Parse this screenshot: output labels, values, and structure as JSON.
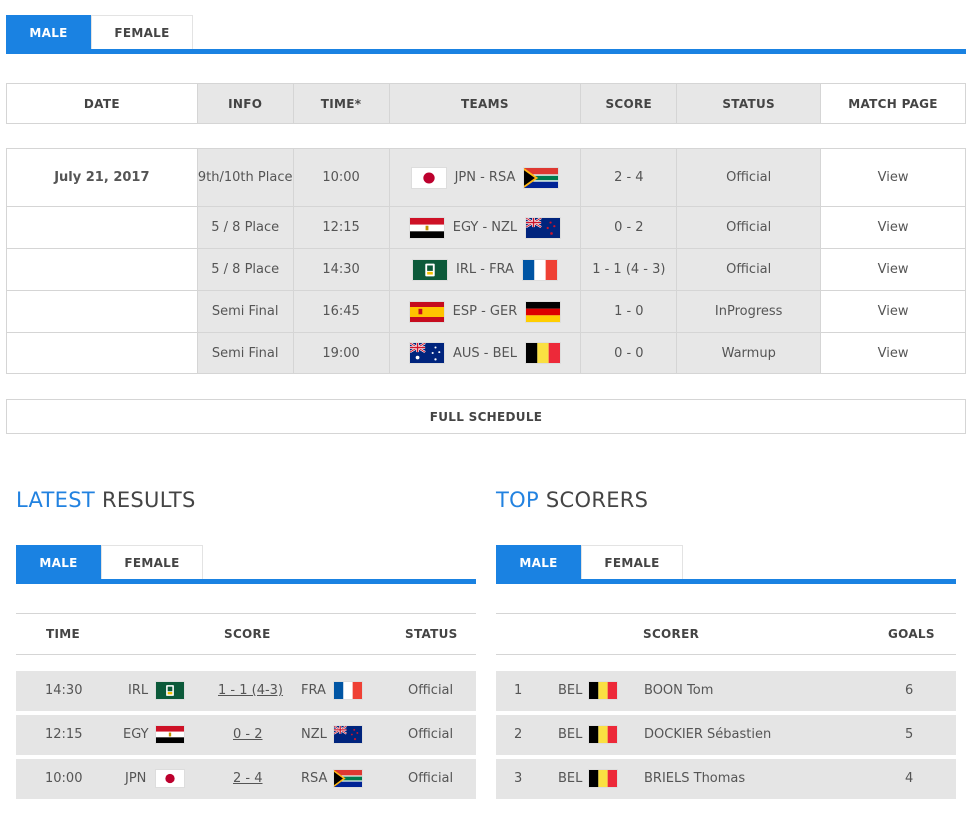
{
  "top_tabs": [
    "MALE",
    "FEMALE"
  ],
  "schedule": {
    "headers": [
      "DATE",
      "INFO",
      "TIME*",
      "TEAMS",
      "SCORE",
      "STATUS",
      "MATCH PAGE"
    ],
    "date": "July 21, 2017",
    "rows": [
      {
        "info": "9th/10th Place",
        "time": "10:00",
        "teams": "JPN - RSA",
        "flag1": "jpn",
        "flag2": "rsa",
        "score": "2 - 4",
        "status": "Official",
        "link": "View"
      },
      {
        "info": "5 / 8 Place",
        "time": "12:15",
        "teams": "EGY - NZL",
        "flag1": "egy",
        "flag2": "nzl",
        "score": "0 - 2",
        "status": "Official",
        "link": "View"
      },
      {
        "info": "5 / 8 Place",
        "time": "14:30",
        "teams": "IRL - FRA",
        "flag1": "irl",
        "flag2": "fra",
        "score": "1 - 1 (4 - 3)",
        "status": "Official",
        "link": "View"
      },
      {
        "info": "Semi Final",
        "time": "16:45",
        "teams": "ESP - GER",
        "flag1": "esp",
        "flag2": "ger",
        "score": "1 - 0",
        "status": "InProgress",
        "link": "View"
      },
      {
        "info": "Semi Final",
        "time": "19:00",
        "teams": "AUS - BEL",
        "flag1": "aus",
        "flag2": "bel",
        "score": "0 - 0",
        "status": "Warmup",
        "link": "View"
      }
    ],
    "full_schedule": "FULL SCHEDULE"
  },
  "latest": {
    "title_hl": "LATEST",
    "title_rest": " RESULTS",
    "tabs": [
      "MALE",
      "FEMALE"
    ],
    "headers": [
      "TIME",
      "SCORE",
      "STATUS"
    ],
    "rows": [
      {
        "time": "14:30",
        "team1": "IRL",
        "flag1": "irl",
        "score": "1 - 1 (4-3)",
        "team2": "FRA",
        "flag2": "fra",
        "status": "Official"
      },
      {
        "time": "12:15",
        "team1": "EGY",
        "flag1": "egy",
        "score": "0 - 2",
        "team2": "NZL",
        "flag2": "nzl",
        "status": "Official"
      },
      {
        "time": "10:00",
        "team1": "JPN",
        "flag1": "jpn",
        "score": "2 - 4",
        "team2": "RSA",
        "flag2": "rsa",
        "status": "Official"
      }
    ]
  },
  "scorers": {
    "title_hl": "TOP",
    "title_rest": " SCORERS",
    "tabs": [
      "MALE",
      "FEMALE"
    ],
    "headers": [
      "SCORER",
      "GOALS"
    ],
    "rows": [
      {
        "rank": "1",
        "team": "BEL",
        "flag": "bel",
        "name": "BOON Tom",
        "goals": "6"
      },
      {
        "rank": "2",
        "team": "BEL",
        "flag": "bel",
        "name": "DOCKIER Sébastien",
        "goals": "5"
      },
      {
        "rank": "3",
        "team": "BEL",
        "flag": "bel",
        "name": "BRIELS Thomas",
        "goals": "4"
      }
    ]
  },
  "colors": {
    "accent": "#1a82e2",
    "link": "#2282e0",
    "row_shade": "#e5e5e5"
  }
}
